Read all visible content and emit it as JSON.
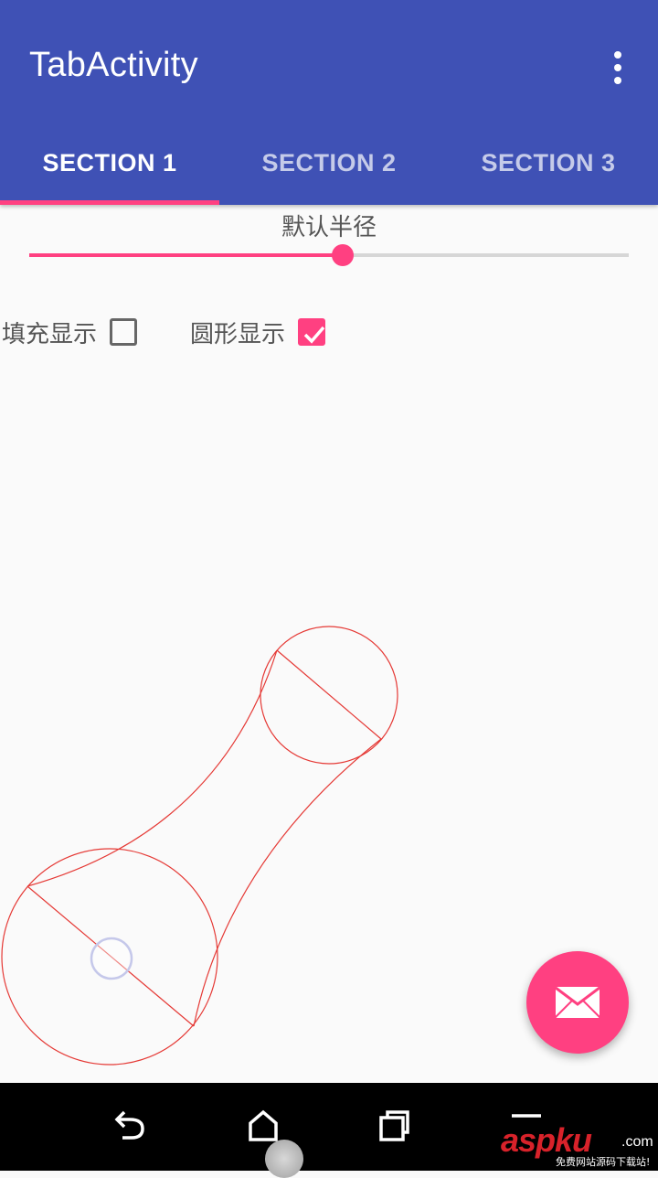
{
  "app_bar": {
    "title": "TabActivity",
    "overflow_icon": "more-vert-icon",
    "background_color": "#3f51b5"
  },
  "tabs": [
    {
      "label": "SECTION 1",
      "selected": true
    },
    {
      "label": "SECTION 2",
      "selected": false
    },
    {
      "label": "SECTION 3",
      "selected": false
    }
  ],
  "accent_color": "#ff4081",
  "radius_slider": {
    "label": "默认半径",
    "value_fraction": 0.523
  },
  "options": {
    "fill_label": "填充显示",
    "fill_checked": false,
    "circle_label": "圆形显示",
    "circle_checked": true
  },
  "fab": {
    "icon": "email-icon"
  },
  "nav_bar": {
    "back_icon": "back-icon",
    "home_icon": "home-icon",
    "recents_icon": "recents-icon",
    "menu_icon": "menu-icon"
  },
  "watermark": {
    "brand": "aspku",
    "domain": ".com",
    "tagline": "免费网站源码下载站!"
  }
}
